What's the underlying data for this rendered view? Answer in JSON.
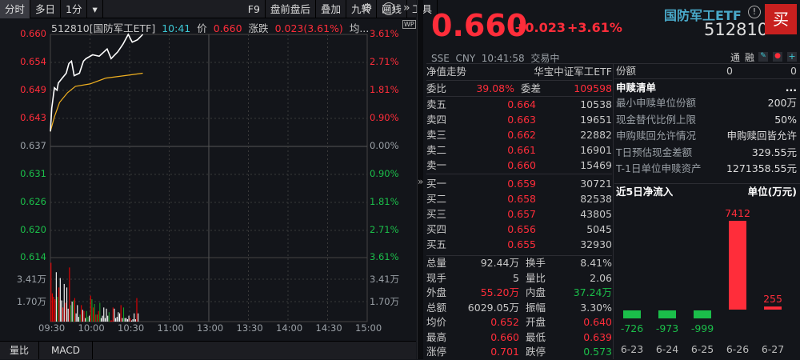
{
  "toolbar": {
    "items": [
      "分时",
      "多日",
      "1分",
      "▾",
      "F9",
      "盘前盘后",
      "叠加",
      "九转",
      "画线",
      "工具"
    ],
    "gear": "⚙",
    "help": "?",
    "more": "»"
  },
  "info": {
    "code": "512810[国防军工ETF]",
    "time": "10:41",
    "price_label": "价",
    "price": "0.660",
    "chg_label": "涨跌",
    "chg": "0.023(3.61%)",
    "avg_label": "均...",
    "wp": "WP"
  },
  "axis": {
    "left_prices": [
      "0.660",
      "0.654",
      "0.649",
      "0.643",
      "0.637",
      "0.631",
      "0.626",
      "0.620",
      "0.614"
    ],
    "right_pcts": [
      "3.61%",
      "2.71%",
      "1.81%",
      "0.90%",
      "0.00%",
      "0.90%",
      "1.81%",
      "2.71%",
      "3.61%"
    ],
    "vol_labels": [
      "3.41万",
      "1.70万"
    ],
    "times": [
      "09:30",
      "10:00",
      "10:30",
      "11:00",
      "13:00",
      "13:30",
      "14:00",
      "14:30",
      "15:00"
    ]
  },
  "chart_data": {
    "type": "line",
    "title": "512810 intraday",
    "prev_close": 0.637,
    "ylim": [
      0.614,
      0.66
    ],
    "price": [
      [
        0,
        0.64
      ],
      [
        1,
        0.6448
      ],
      [
        3,
        0.649
      ],
      [
        5,
        0.6485
      ],
      [
        6,
        0.65
      ],
      [
        9,
        0.651
      ],
      [
        12,
        0.652
      ],
      [
        14,
        0.654
      ],
      [
        16,
        0.6545
      ],
      [
        18,
        0.6515
      ],
      [
        22,
        0.652
      ],
      [
        25,
        0.6545
      ],
      [
        27,
        0.655
      ],
      [
        32,
        0.6558
      ],
      [
        37,
        0.6555
      ],
      [
        43,
        0.657
      ],
      [
        46,
        0.655
      ],
      [
        51,
        0.6564
      ],
      [
        55,
        0.658
      ],
      [
        59,
        0.66
      ],
      [
        62,
        0.6584
      ],
      [
        66,
        0.6589
      ],
      [
        70,
        0.66
      ]
    ],
    "avg": [
      [
        0,
        0.64
      ],
      [
        3,
        0.643
      ],
      [
        7,
        0.646
      ],
      [
        13,
        0.648
      ],
      [
        19,
        0.6493
      ],
      [
        30,
        0.6498
      ],
      [
        42,
        0.651
      ],
      [
        56,
        0.6515
      ],
      [
        70,
        0.652
      ]
    ],
    "volume": [
      [
        0,
        5.0,
        "r"
      ],
      [
        1,
        2.4,
        "r"
      ],
      [
        2,
        2.1,
        "r"
      ],
      [
        3,
        1.9,
        "r"
      ],
      [
        4,
        4.2,
        "w"
      ],
      [
        5,
        2.1,
        "g"
      ],
      [
        6,
        2.9,
        "r"
      ],
      [
        7,
        3.7,
        "w"
      ],
      [
        8,
        1.8,
        "w"
      ],
      [
        9,
        1.2,
        "r"
      ],
      [
        10,
        3.2,
        "w"
      ],
      [
        11,
        1.6,
        "r"
      ],
      [
        12,
        2.9,
        "w"
      ],
      [
        13,
        1.1,
        "w"
      ],
      [
        14,
        4.6,
        "r"
      ],
      [
        15,
        1.4,
        "g"
      ],
      [
        16,
        1.7,
        "w"
      ],
      [
        17,
        1.8,
        "g"
      ],
      [
        18,
        2.0,
        "r"
      ],
      [
        19,
        0.7,
        "w"
      ],
      [
        20,
        1.4,
        "w"
      ],
      [
        21,
        0.4,
        "w"
      ],
      [
        22,
        0.6,
        "g"
      ],
      [
        23,
        1.4,
        "r"
      ],
      [
        24,
        1.0,
        "w"
      ],
      [
        25,
        0.9,
        "r"
      ],
      [
        26,
        0.3,
        "w"
      ],
      [
        27,
        0.9,
        "g"
      ],
      [
        28,
        0.4,
        "g"
      ],
      [
        29,
        0.5,
        "w"
      ],
      [
        30,
        2.2,
        "r"
      ],
      [
        31,
        1.9,
        "g"
      ],
      [
        32,
        1.2,
        "r"
      ],
      [
        33,
        1.5,
        "g"
      ],
      [
        34,
        0.6,
        "r"
      ],
      [
        35,
        0.6,
        "g"
      ],
      [
        36,
        0.9,
        "r"
      ],
      [
        37,
        1.6,
        "g"
      ],
      [
        38,
        0.3,
        "w"
      ],
      [
        39,
        0.5,
        "w"
      ],
      [
        40,
        1.2,
        "w"
      ],
      [
        41,
        0.3,
        "w"
      ],
      [
        42,
        1.1,
        "w"
      ],
      [
        43,
        0.5,
        "w"
      ],
      [
        44,
        0.8,
        "g"
      ],
      [
        45,
        0.1,
        "r"
      ],
      [
        46,
        0.1,
        "r"
      ],
      [
        47,
        1.2,
        "r"
      ],
      [
        48,
        1.1,
        "w"
      ],
      [
        49,
        0.3,
        "w"
      ],
      [
        50,
        0.4,
        "w"
      ],
      [
        51,
        0.8,
        "w"
      ],
      [
        52,
        0.7,
        "w"
      ],
      [
        53,
        1.4,
        "r"
      ],
      [
        54,
        0.3,
        "w"
      ],
      [
        55,
        1.2,
        "g"
      ],
      [
        56,
        0.3,
        "w"
      ],
      [
        57,
        0.3,
        "w"
      ],
      [
        58,
        0.2,
        "w"
      ],
      [
        59,
        0.5,
        "w"
      ],
      [
        60,
        0.3,
        "r"
      ],
      [
        61,
        0.1,
        "w"
      ],
      [
        62,
        0.2,
        "w"
      ],
      [
        63,
        0.7,
        "w"
      ],
      [
        64,
        0.2,
        "w"
      ],
      [
        65,
        2.0,
        "r"
      ],
      [
        66,
        0.7,
        "w"
      ]
    ]
  },
  "bottom_tabs": [
    "量比",
    "MACD"
  ],
  "quote": {
    "price": "0.660",
    "chg": "+0.023",
    "pct": "+3.61%",
    "name": "国防军工ETF",
    "alert": "!",
    "code": "512810",
    "buy": "买",
    "market": "SSE",
    "currency": "CNY",
    "time": "10:41:58",
    "status": "交易中",
    "tong": "通",
    "rong": "融"
  },
  "nav": {
    "label": "净值走势",
    "name": "华宝中证军工ETF"
  },
  "book": {
    "wb_label": "委比",
    "wb": "39.08%",
    "wc_label": "委差",
    "wc": "109598",
    "asks": [
      [
        "卖五",
        "0.664",
        "10538"
      ],
      [
        "卖四",
        "0.663",
        "19651"
      ],
      [
        "卖三",
        "0.662",
        "22882"
      ],
      [
        "卖二",
        "0.661",
        "16901"
      ],
      [
        "卖一",
        "0.660",
        "15469"
      ]
    ],
    "bids": [
      [
        "买一",
        "0.659",
        "30721"
      ],
      [
        "买二",
        "0.658",
        "82538"
      ],
      [
        "买三",
        "0.657",
        "43805"
      ],
      [
        "买四",
        "0.656",
        "5045"
      ],
      [
        "买五",
        "0.655",
        "32930"
      ]
    ]
  },
  "stats": [
    [
      "总量",
      "92.44万",
      "",
      "换手",
      "8.41%",
      ""
    ],
    [
      "现手",
      "5",
      "",
      "量比",
      "2.06",
      ""
    ],
    [
      "外盘",
      "55.20万",
      "red",
      "内盘",
      "37.24万",
      "green"
    ],
    [
      "总额",
      "6029.05万",
      "",
      "振幅",
      "3.30%",
      ""
    ],
    [
      "均价",
      "0.652",
      "red",
      "开盘",
      "0.640",
      "red"
    ],
    [
      "最高",
      "0.660",
      "red",
      "最低",
      "0.639",
      "red"
    ],
    [
      "涨停",
      "0.701",
      "red",
      "跌停",
      "0.573",
      "green"
    ]
  ],
  "shares": {
    "label": "份额",
    "v1": "0",
    "v2": "0"
  },
  "creation": {
    "title": "申赎清单",
    "more": "...",
    "rows": [
      [
        "最小申赎单位份额",
        "200万"
      ],
      [
        "现金替代比例上限",
        "50%"
      ],
      [
        "申购赎回允许情况",
        "申购赎回皆允许"
      ],
      [
        "T日预估现金差额",
        "329.55元"
      ],
      [
        "T-1日单位申赎资产",
        "1271358.55元"
      ]
    ]
  },
  "flow": {
    "title": "近5日净流入",
    "unit": "单位(万元)",
    "categories": [
      "6-23",
      "6-24",
      "6-25",
      "6-26",
      "6-27"
    ],
    "values": [
      -726,
      -973,
      -999,
      7412,
      255
    ],
    "labels": [
      "-726",
      "-973",
      "-999",
      "7412",
      "255"
    ]
  }
}
